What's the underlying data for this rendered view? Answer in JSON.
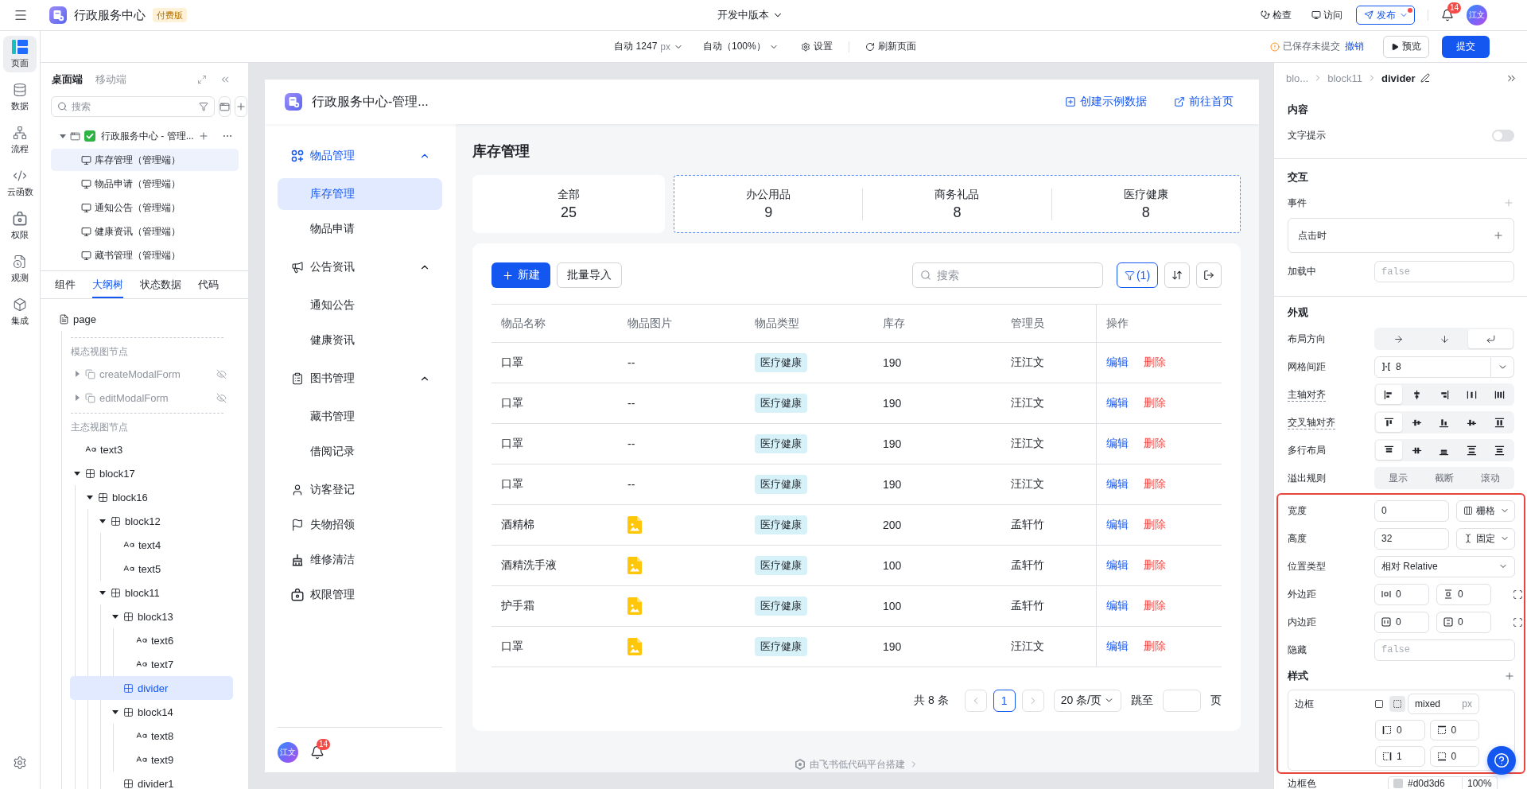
{
  "topbar": {
    "app_title": "行政服务中心",
    "plan_badge": "付费版",
    "version": "开发中版本",
    "actions": [
      {
        "label": "检查"
      },
      {
        "label": "访问"
      }
    ],
    "publish": {
      "label": "发布",
      "has_update": true
    },
    "notification_count": "14",
    "avatar": "江文"
  },
  "rail": [
    {
      "label": "页面",
      "selected": true
    },
    {
      "label": "数据",
      "selected": false
    },
    {
      "label": "流程",
      "selected": false
    },
    {
      "label": "云函数",
      "selected": false
    },
    {
      "label": "权限",
      "selected": false
    },
    {
      "label": "观测",
      "selected": false
    },
    {
      "label": "集成",
      "selected": false
    }
  ],
  "toolbar": {
    "canvas_width": "自动 1247",
    "width_unit": "px",
    "zoom": "自动（100%）",
    "settings": "设置",
    "refresh": "刷新页面",
    "save_status": "已保存未提交",
    "undo": "撤销",
    "preview": "预览",
    "submit": "提交"
  },
  "left_panel": {
    "tabs": [
      {
        "label": "桌面端",
        "selected": true
      },
      {
        "label": "移动端",
        "selected": false
      }
    ],
    "search": {
      "placeholder": "搜索"
    },
    "app_node": {
      "label": "行政服务中心 - 管理...",
      "expanded": true
    },
    "pages": [
      {
        "label": "库存管理（管理端）",
        "selected": true
      },
      {
        "label": "物品申请（管理端）",
        "selected": false
      },
      {
        "label": "通知公告（管理端）",
        "selected": false
      },
      {
        "label": "健康资讯（管理端）",
        "selected": false
      },
      {
        "label": "藏书管理（管理端）",
        "selected": false
      }
    ],
    "bottom_tabs": [
      {
        "label": "组件",
        "selected": false
      },
      {
        "label": "大纲树",
        "selected": true
      },
      {
        "label": "状态数据",
        "selected": false
      },
      {
        "label": "代码",
        "selected": false
      }
    ],
    "outline": {
      "root": "page",
      "modal_heading": "模态视图节点",
      "modal_nodes": [
        {
          "label": "createModalForm",
          "expanded": false,
          "hidden": true
        },
        {
          "label": "editModalForm",
          "expanded": false,
          "hidden": true
        }
      ],
      "main_heading": "主态视图节点",
      "nodes": [
        {
          "label": "text3",
          "kind": "text",
          "selected": false
        },
        {
          "label": "block17",
          "kind": "block",
          "selected": false,
          "expanded": true,
          "children": [
            {
              "label": "block16",
              "kind": "block",
              "selected": false,
              "expanded": true,
              "children": [
                {
                  "label": "block12",
                  "kind": "block",
                  "selected": false,
                  "expanded": true,
                  "children": [
                    {
                      "label": "text4",
                      "kind": "text",
                      "selected": false
                    },
                    {
                      "label": "text5",
                      "kind": "text",
                      "selected": false
                    }
                  ]
                },
                {
                  "label": "block11",
                  "kind": "block",
                  "selected": false,
                  "expanded": true,
                  "children": [
                    {
                      "label": "block13",
                      "kind": "block",
                      "selected": false,
                      "expanded": true,
                      "children": [
                        {
                          "label": "text6",
                          "kind": "text",
                          "selected": false
                        },
                        {
                          "label": "text7",
                          "kind": "text",
                          "selected": false
                        }
                      ]
                    },
                    {
                      "label": "divider",
                      "kind": "block",
                      "selected": true
                    },
                    {
                      "label": "block14",
                      "kind": "block",
                      "selected": false,
                      "expanded": true,
                      "children": [
                        {
                          "label": "text8",
                          "kind": "text",
                          "selected": false
                        },
                        {
                          "label": "text9",
                          "kind": "text",
                          "selected": false
                        }
                      ]
                    },
                    {
                      "label": "divider1",
                      "kind": "block",
                      "selected": false
                    }
                  ]
                }
              ]
            }
          ]
        }
      ]
    }
  },
  "preview": {
    "app_title": "行政服务中心-管理...",
    "header_links": [
      {
        "label": "创建示例数据"
      },
      {
        "label": "前往首页"
      }
    ],
    "menu": [
      {
        "label": "物品管理",
        "expanded": true,
        "children": [
          {
            "label": "库存管理",
            "selected": true
          },
          {
            "label": "物品申请",
            "selected": false
          }
        ]
      },
      {
        "label": "公告资讯",
        "expanded": true,
        "children": [
          {
            "label": "通知公告",
            "selected": false
          },
          {
            "label": "健康资讯",
            "selected": false
          }
        ]
      },
      {
        "label": "图书管理",
        "expanded": true,
        "children": [
          {
            "label": "藏书管理",
            "selected": false
          },
          {
            "label": "借阅记录",
            "selected": false
          }
        ]
      },
      {
        "label": "访客登记",
        "selected": false
      },
      {
        "label": "失物招领",
        "selected": false
      },
      {
        "label": "维修清洁",
        "selected": false
      },
      {
        "label": "权限管理",
        "selected": false
      }
    ],
    "user": {
      "avatar": "江文",
      "notification_count": "14"
    },
    "page_title": "库存管理",
    "summary": {
      "total": {
        "label": "全部",
        "value": "25"
      },
      "categories_highlighted": true,
      "categories": [
        {
          "label": "办公用品",
          "value": "9"
        },
        {
          "label": "商务礼品",
          "value": "8"
        },
        {
          "label": "医疗健康",
          "value": "8"
        }
      ]
    },
    "table": {
      "create_button": "新建",
      "import_button": "批量导入",
      "search": {
        "placeholder": "搜索"
      },
      "filter_count": "(1)",
      "filter_active": true,
      "columns": [
        "物品名称",
        "物品图片",
        "物品类型",
        "库存",
        "管理员",
        "操作"
      ],
      "rows": [
        {
          "name": "口罩",
          "image": {
            "kind": "empty",
            "text": "--"
          },
          "category": "医疗健康",
          "stock": "190",
          "manager": "汪江文",
          "actions": [
            {
              "label": "编辑",
              "kind": "edit"
            },
            {
              "label": "删除",
              "kind": "delete"
            }
          ]
        },
        {
          "name": "口罩",
          "image": {
            "kind": "empty",
            "text": "--"
          },
          "category": "医疗健康",
          "stock": "190",
          "manager": "汪江文",
          "actions": [
            {
              "label": "编辑",
              "kind": "edit"
            },
            {
              "label": "删除",
              "kind": "delete"
            }
          ]
        },
        {
          "name": "口罩",
          "image": {
            "kind": "empty",
            "text": "--"
          },
          "category": "医疗健康",
          "stock": "190",
          "manager": "汪江文",
          "actions": [
            {
              "label": "编辑",
              "kind": "edit"
            },
            {
              "label": "删除",
              "kind": "delete"
            }
          ]
        },
        {
          "name": "口罩",
          "image": {
            "kind": "empty",
            "text": "--"
          },
          "category": "医疗健康",
          "stock": "190",
          "manager": "汪江文",
          "actions": [
            {
              "label": "编辑",
              "kind": "edit"
            },
            {
              "label": "删除",
              "kind": "delete"
            }
          ]
        },
        {
          "name": "酒精棉",
          "image": {
            "kind": "file"
          },
          "category": "医疗健康",
          "stock": "200",
          "manager": "孟轩竹",
          "actions": [
            {
              "label": "编辑",
              "kind": "edit"
            },
            {
              "label": "删除",
              "kind": "delete"
            }
          ]
        },
        {
          "name": "酒精洗手液",
          "image": {
            "kind": "file"
          },
          "category": "医疗健康",
          "stock": "100",
          "manager": "孟轩竹",
          "actions": [
            {
              "label": "编辑",
              "kind": "edit"
            },
            {
              "label": "删除",
              "kind": "delete"
            }
          ]
        },
        {
          "name": "护手霜",
          "image": {
            "kind": "file"
          },
          "category": "医疗健康",
          "stock": "100",
          "manager": "孟轩竹",
          "actions": [
            {
              "label": "编辑",
              "kind": "edit"
            },
            {
              "label": "删除",
              "kind": "delete"
            }
          ]
        },
        {
          "name": "口罩",
          "image": {
            "kind": "file"
          },
          "category": "医疗健康",
          "stock": "190",
          "manager": "汪江文",
          "actions": [
            {
              "label": "编辑",
              "kind": "edit"
            },
            {
              "label": "删除",
              "kind": "delete"
            }
          ]
        }
      ],
      "pagination": {
        "total": "共 8 条",
        "prev_disabled": true,
        "pages": [
          {
            "label": "1",
            "selected": true
          }
        ],
        "next_disabled": true,
        "page_size": "20 条/页",
        "jump_label": "跳至",
        "page_suffix": "页"
      }
    },
    "footer": "由飞书低代码平台搭建"
  },
  "inspector": {
    "breadcrumb": [
      "blo...",
      "block11",
      "divider"
    ],
    "content": {
      "title": "内容",
      "text_tip": {
        "label": "文字提示",
        "on": false
      }
    },
    "interaction": {
      "title": "交互",
      "events_label": "事件",
      "events": [
        {
          "label": "点击时"
        }
      ],
      "loading": {
        "label": "加载中",
        "placeholder": "false"
      }
    },
    "appearance": {
      "title": "外观",
      "rows": [
        {
          "kind": "direction",
          "label": "布局方向",
          "hint": false,
          "options": [
            {
              "selected": false
            },
            {
              "selected": false
            },
            {
              "selected": true
            }
          ]
        },
        {
          "kind": "gap",
          "label": "网格间距",
          "hint": false,
          "value": "8"
        },
        {
          "kind": "main_align",
          "label": "主轴对齐",
          "hint": true,
          "options": [
            {
              "selected": true
            },
            {
              "selected": false
            },
            {
              "selected": false
            },
            {
              "selected": false
            },
            {
              "selected": false
            }
          ]
        },
        {
          "kind": "cross_align",
          "label": "交叉轴对齐",
          "hint": true,
          "options": [
            {
              "selected": true
            },
            {
              "selected": false
            },
            {
              "selected": false
            },
            {
              "selected": false
            },
            {
              "selected": false
            }
          ]
        },
        {
          "kind": "wrap_align",
          "label": "多行布局",
          "hint": false,
          "options": [
            {
              "selected": true
            },
            {
              "selected": false
            },
            {
              "selected": false
            },
            {
              "selected": false
            },
            {
              "selected": false
            }
          ]
        },
        {
          "kind": "overflow",
          "label": "溢出规则",
          "hint": false,
          "options": [
            {
              "label": "显示",
              "selected": false
            },
            {
              "label": "截断",
              "selected": false
            },
            {
              "label": "滚动",
              "selected": false
            }
          ]
        }
      ]
    },
    "highlight_frame": true,
    "size_rows": [
      {
        "kind": "size",
        "label": "宽度",
        "value": "0",
        "unit": "栅格"
      },
      {
        "kind": "size",
        "label": "高度",
        "value": "32",
        "unit": "固定"
      },
      {
        "kind": "select",
        "label": "位置类型",
        "value": "相对 Relative"
      },
      {
        "kind": "spacing",
        "label": "外边距",
        "values": [
          "0",
          "0"
        ]
      },
      {
        "kind": "spacing",
        "label": "内边距",
        "values": [
          "0",
          "0"
        ]
      },
      {
        "kind": "input",
        "label": "隐藏",
        "placeholder": "false"
      }
    ],
    "style": {
      "title": "样式",
      "border": {
        "label": "边框",
        "modes": [
          {
            "selected": false
          },
          {
            "selected": true
          }
        ],
        "value": "mixed",
        "unit": "px",
        "sides": [
          "0",
          "0",
          "1",
          "0"
        ]
      },
      "border_color": {
        "label": "边框色",
        "value": "#d0d3d6",
        "opacity": "100%"
      }
    }
  }
}
